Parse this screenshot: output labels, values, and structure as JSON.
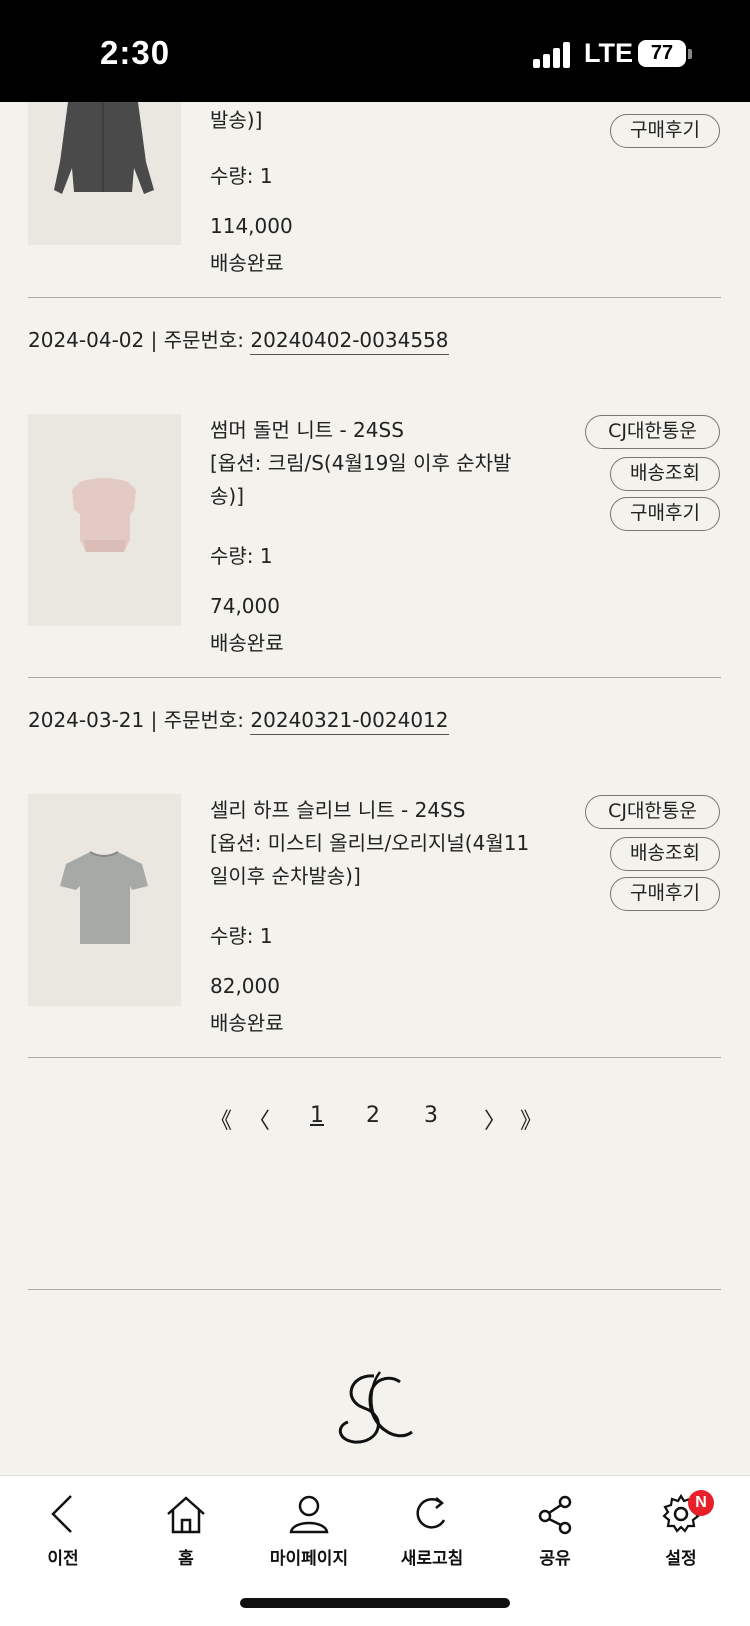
{
  "status_bar": {
    "time": "2:30",
    "network": "LTE",
    "battery": "77"
  },
  "orders": [
    {
      "name_tail": "발송)]",
      "qty": "수량: 1",
      "price": "114,000",
      "status": "배송완료",
      "review_label": "구매후기"
    },
    {
      "date": "2024-04-02",
      "sep": "|",
      "order_no_label": "주문번호:",
      "order_no": "20240402-0034558",
      "name": "썸머 돌먼 니트 - 24SS",
      "option": "[옵션: 크림/S(4월19일 이후 순차발송)]",
      "qty": "수량: 1",
      "price": "74,000",
      "status": "배송완료",
      "carrier_label": "CJ대한통운",
      "track_label": "배송조회",
      "review_label": "구매후기"
    },
    {
      "date": "2024-03-21",
      "sep": "|",
      "order_no_label": "주문번호:",
      "order_no": "20240321-0024012",
      "name": "셀리 하프 슬리브 니트 - 24SS",
      "option": "[옵션: 미스티 올리브/오리지널(4월11일이후 순차발송)]",
      "qty": "수량: 1",
      "price": "82,000",
      "status": "배송완료",
      "carrier_label": "CJ대한통운",
      "track_label": "배송조회",
      "review_label": "구매후기"
    }
  ],
  "pagination": {
    "first": "《",
    "prev": "〈",
    "pages": [
      "1",
      "2",
      "3"
    ],
    "current": "1",
    "next": "〉",
    "last": "》"
  },
  "bottom_nav": {
    "back": "이전",
    "home": "홈",
    "mypage": "마이페이지",
    "refresh": "새로고침",
    "share": "공유",
    "settings": "설정",
    "settings_badge": "N"
  }
}
